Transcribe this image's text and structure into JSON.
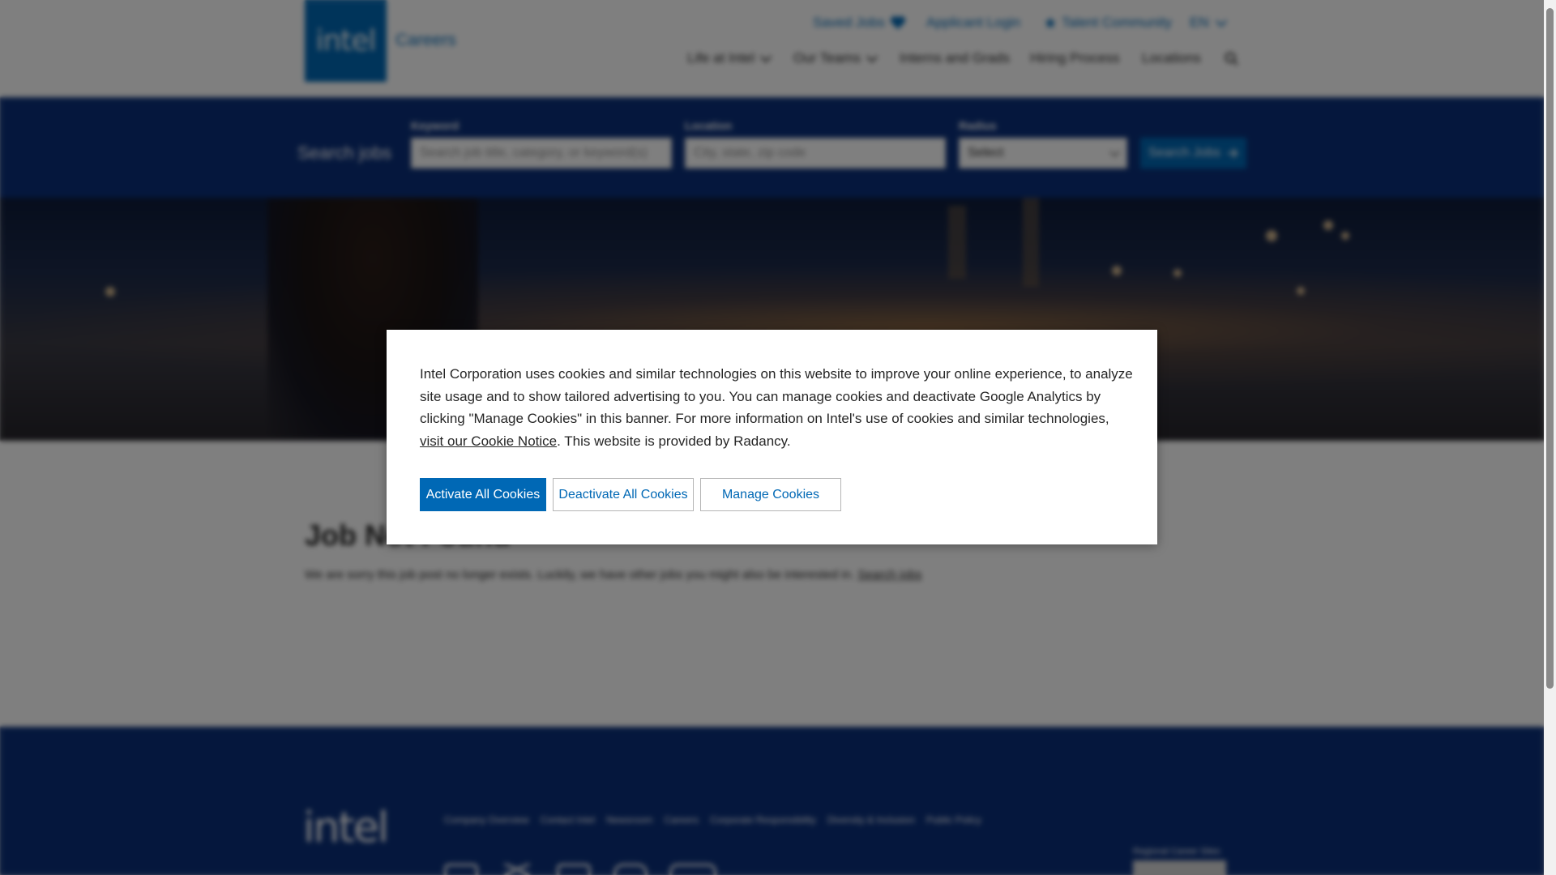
{
  "header": {
    "logo_text": "intel",
    "careers_label": "Careers",
    "utility_links": {
      "saved_jobs": "Saved Jobs",
      "applicant_login": "Applicant Login",
      "talent_community": "Talent Community",
      "language": "EN"
    },
    "nav": {
      "life_at_intel": "Life at Intel",
      "our_teams": "Our Teams",
      "interns_grads": "Interns and Grads",
      "hiring_process": "Hiring Process",
      "locations": "Locations"
    }
  },
  "search": {
    "title": "Search jobs",
    "keyword_label": "Keyword",
    "keyword_placeholder": "Search job title, category, or keyword(s)",
    "location_label": "Location",
    "location_placeholder": "City, state, zip code",
    "radius_label": "Radius",
    "radius_value": "Select",
    "button_label": "Search Jobs"
  },
  "content": {
    "title": "Job Not Found",
    "message": "We are sorry this job post no longer exists. Luckily, we have other jobs you might also be interested in.",
    "link": "Search jobs"
  },
  "footer": {
    "logo_text": "intel",
    "links": [
      "Company Overview",
      "Contact Intel",
      "Newsroom",
      "Careers",
      "Corporate Responsibility",
      "Diversity & Inclusion",
      "Public Policy"
    ],
    "regional_label": "Regional Career Sites"
  },
  "cookie_banner": {
    "text": "Intel Corporation uses cookies and similar technologies on this website to improve your online experience, to analyze site usage and to show tailored advertising to you. You can manage cookies and deactivate Google Analytics by clicking \"Manage Cookies\" in this banner. For more information on Intel's use of cookies and similar technologies, ",
    "link_text": "visit our Cookie Notice",
    "text_end": ". This website is provided by Radancy.",
    "activate_label": "Activate All Cookies",
    "deactivate_label": "Deactivate All Cookies",
    "manage_label": "Manage Cookies"
  },
  "colors": {
    "brand_blue": "#0068b5",
    "search_bar_bg": "#0a2f7a",
    "overlay": "rgba(0,0,0,0.5)"
  },
  "icons": [
    "heart-icon",
    "star-icon",
    "chevron-down-icon",
    "search-icon",
    "arrow-right-icon",
    "facebook-icon",
    "x-icon",
    "linkedin-icon",
    "instagram-icon",
    "youtube-icon"
  ]
}
